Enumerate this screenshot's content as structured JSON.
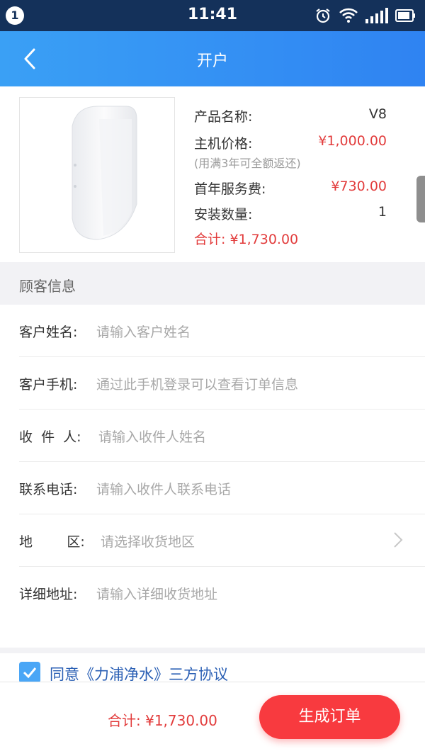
{
  "status_bar": {
    "notification_count": "1",
    "time": "11:41",
    "icons": [
      "alarm-icon",
      "wifi-icon",
      "signal-icon",
      "battery-icon"
    ]
  },
  "nav": {
    "title": "开户",
    "back_icon": "chevron-left-icon"
  },
  "product": {
    "name_label": "产品名称:",
    "name_value": "V8",
    "price_label": "主机价格:",
    "price_value": "¥1,000.00",
    "price_note": "(用满3年可全额返还)",
    "service_label": "首年服务费:",
    "service_value": "¥730.00",
    "qty_label": "安装数量:",
    "qty_value": "1",
    "total_text": "合计: ¥1,730.00"
  },
  "customer_section": {
    "title": "顾客信息"
  },
  "form": {
    "fields": [
      {
        "label": "客户姓名:",
        "placeholder": "请输入客户姓名"
      },
      {
        "label": "客户手机:",
        "placeholder": "通过此手机登录可以查看订单信息"
      },
      {
        "label": "收  件  人:",
        "placeholder": "请输入收件人姓名"
      },
      {
        "label": "联系电话:",
        "placeholder": "请输入收件人联系电话"
      },
      {
        "label": "地        区:",
        "placeholder": "请选择收货地区"
      },
      {
        "label": "详细地址:",
        "placeholder": "请输入详细收货地址"
      }
    ]
  },
  "agreement": {
    "checked": true,
    "text": "同意《力浦净水》三方协议"
  },
  "footer": {
    "total_text": "合计: ¥1,730.00",
    "submit_label": "生成订单"
  },
  "colors": {
    "nav_start": "#3aa0f5",
    "nav_end": "#2f83f2",
    "status_bar": "#14315a",
    "price_red": "#e23c3c",
    "submit_red": "#f83a3f",
    "checkbox_blue": "#4aa6f6",
    "agreement_link": "#2a5fb4"
  }
}
